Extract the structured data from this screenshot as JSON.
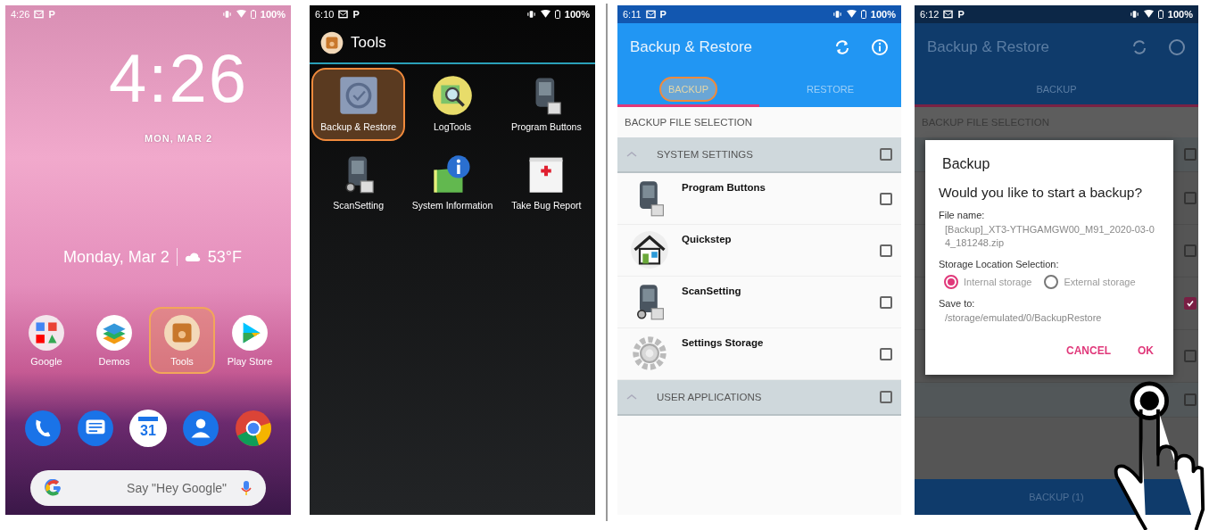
{
  "home_screen": {
    "status_bar": {
      "time": "4:26",
      "glyph": "P",
      "battery": "100%"
    },
    "clock": "4:26",
    "clock_date": "MON, MAR 2",
    "glance": {
      "date": "Monday, Mar 2",
      "temperature": "53°F"
    },
    "apps": [
      {
        "kind": "folder",
        "label": "Google",
        "highlighted": false
      },
      {
        "kind": "layers",
        "label": "Demos",
        "highlighted": false
      },
      {
        "kind": "toolbox",
        "label": "Tools",
        "highlighted": true
      },
      {
        "kind": "play",
        "label": "Play Store",
        "highlighted": false
      }
    ],
    "dock": [
      {
        "kind": "phone"
      },
      {
        "kind": "messages"
      },
      {
        "kind": "calendar",
        "text": "31"
      },
      {
        "kind": "contacts"
      },
      {
        "kind": "browser"
      }
    ],
    "search": {
      "placeholder": "Say \"Hey Google\""
    }
  },
  "tools_screen": {
    "status_bar": {
      "time": "6:10",
      "glyph": "P",
      "battery": "100%"
    },
    "title": "Tools",
    "apps": [
      {
        "kind": "backup",
        "label": "Backup & Restore",
        "highlighted": true
      },
      {
        "kind": "log",
        "label": "LogTools",
        "highlighted": false
      },
      {
        "kind": "device",
        "label": "Program Buttons",
        "highlighted": false
      },
      {
        "kind": "scanner",
        "label": "ScanSetting",
        "highlighted": false
      },
      {
        "kind": "info",
        "label": "System Information",
        "highlighted": false
      },
      {
        "kind": "bug",
        "label": "Take Bug Report",
        "highlighted": false
      }
    ]
  },
  "backup_screen": {
    "status_bar": {
      "time": "6:11",
      "glyph": "P",
      "battery": "100%"
    },
    "title": "Backup & Restore",
    "tabs": [
      {
        "label": "BACKUP",
        "selected": true,
        "highlighted": true
      },
      {
        "label": "RESTORE",
        "selected": false,
        "highlighted": false
      }
    ],
    "section": "BACKUP FILE SELECTION",
    "groups": [
      {
        "label": "SYSTEM SETTINGS",
        "checked": false,
        "items": [
          {
            "kind": "device",
            "label": "Program Buttons",
            "checked": false
          },
          {
            "kind": "house",
            "label": "Quickstep",
            "checked": false
          },
          {
            "kind": "scanner",
            "label": "ScanSetting",
            "checked": false
          },
          {
            "kind": "gear",
            "label": "Settings Storage",
            "checked": false
          }
        ]
      },
      {
        "label": "USER APPLICATIONS",
        "checked": false
      }
    ]
  },
  "dialog_screen": {
    "status_bar": {
      "time": "6:12",
      "glyph": "P",
      "battery": "100%"
    },
    "title": "Backup & Restore",
    "tabs": [
      {
        "label": "BACKUP",
        "selected": true
      }
    ],
    "section": "BACKUP FILE SELECTION",
    "background_rows": [
      {
        "checked": false
      },
      {
        "checked": false
      },
      {
        "checked": false
      },
      {
        "checked": true
      },
      {
        "checked": false
      },
      {
        "checked": false
      }
    ],
    "bottom_button": "BACKUP (1)",
    "dialog": {
      "title": "Backup",
      "question": "Would you like to start a backup?",
      "file_name_label": "File name:",
      "file_name": "[Backup]_XT3-YTHGAMGW00_M91_2020-03-04_181248.zip",
      "storage_label": "Storage Location Selection:",
      "options": [
        {
          "label": "Internal storage",
          "selected": true
        },
        {
          "label": "External storage",
          "selected": false
        }
      ],
      "save_to_label": "Save to:",
      "save_path": "/storage/emulated/0/BackupRestore",
      "buttons": [
        "CANCEL",
        "OK"
      ]
    }
  }
}
